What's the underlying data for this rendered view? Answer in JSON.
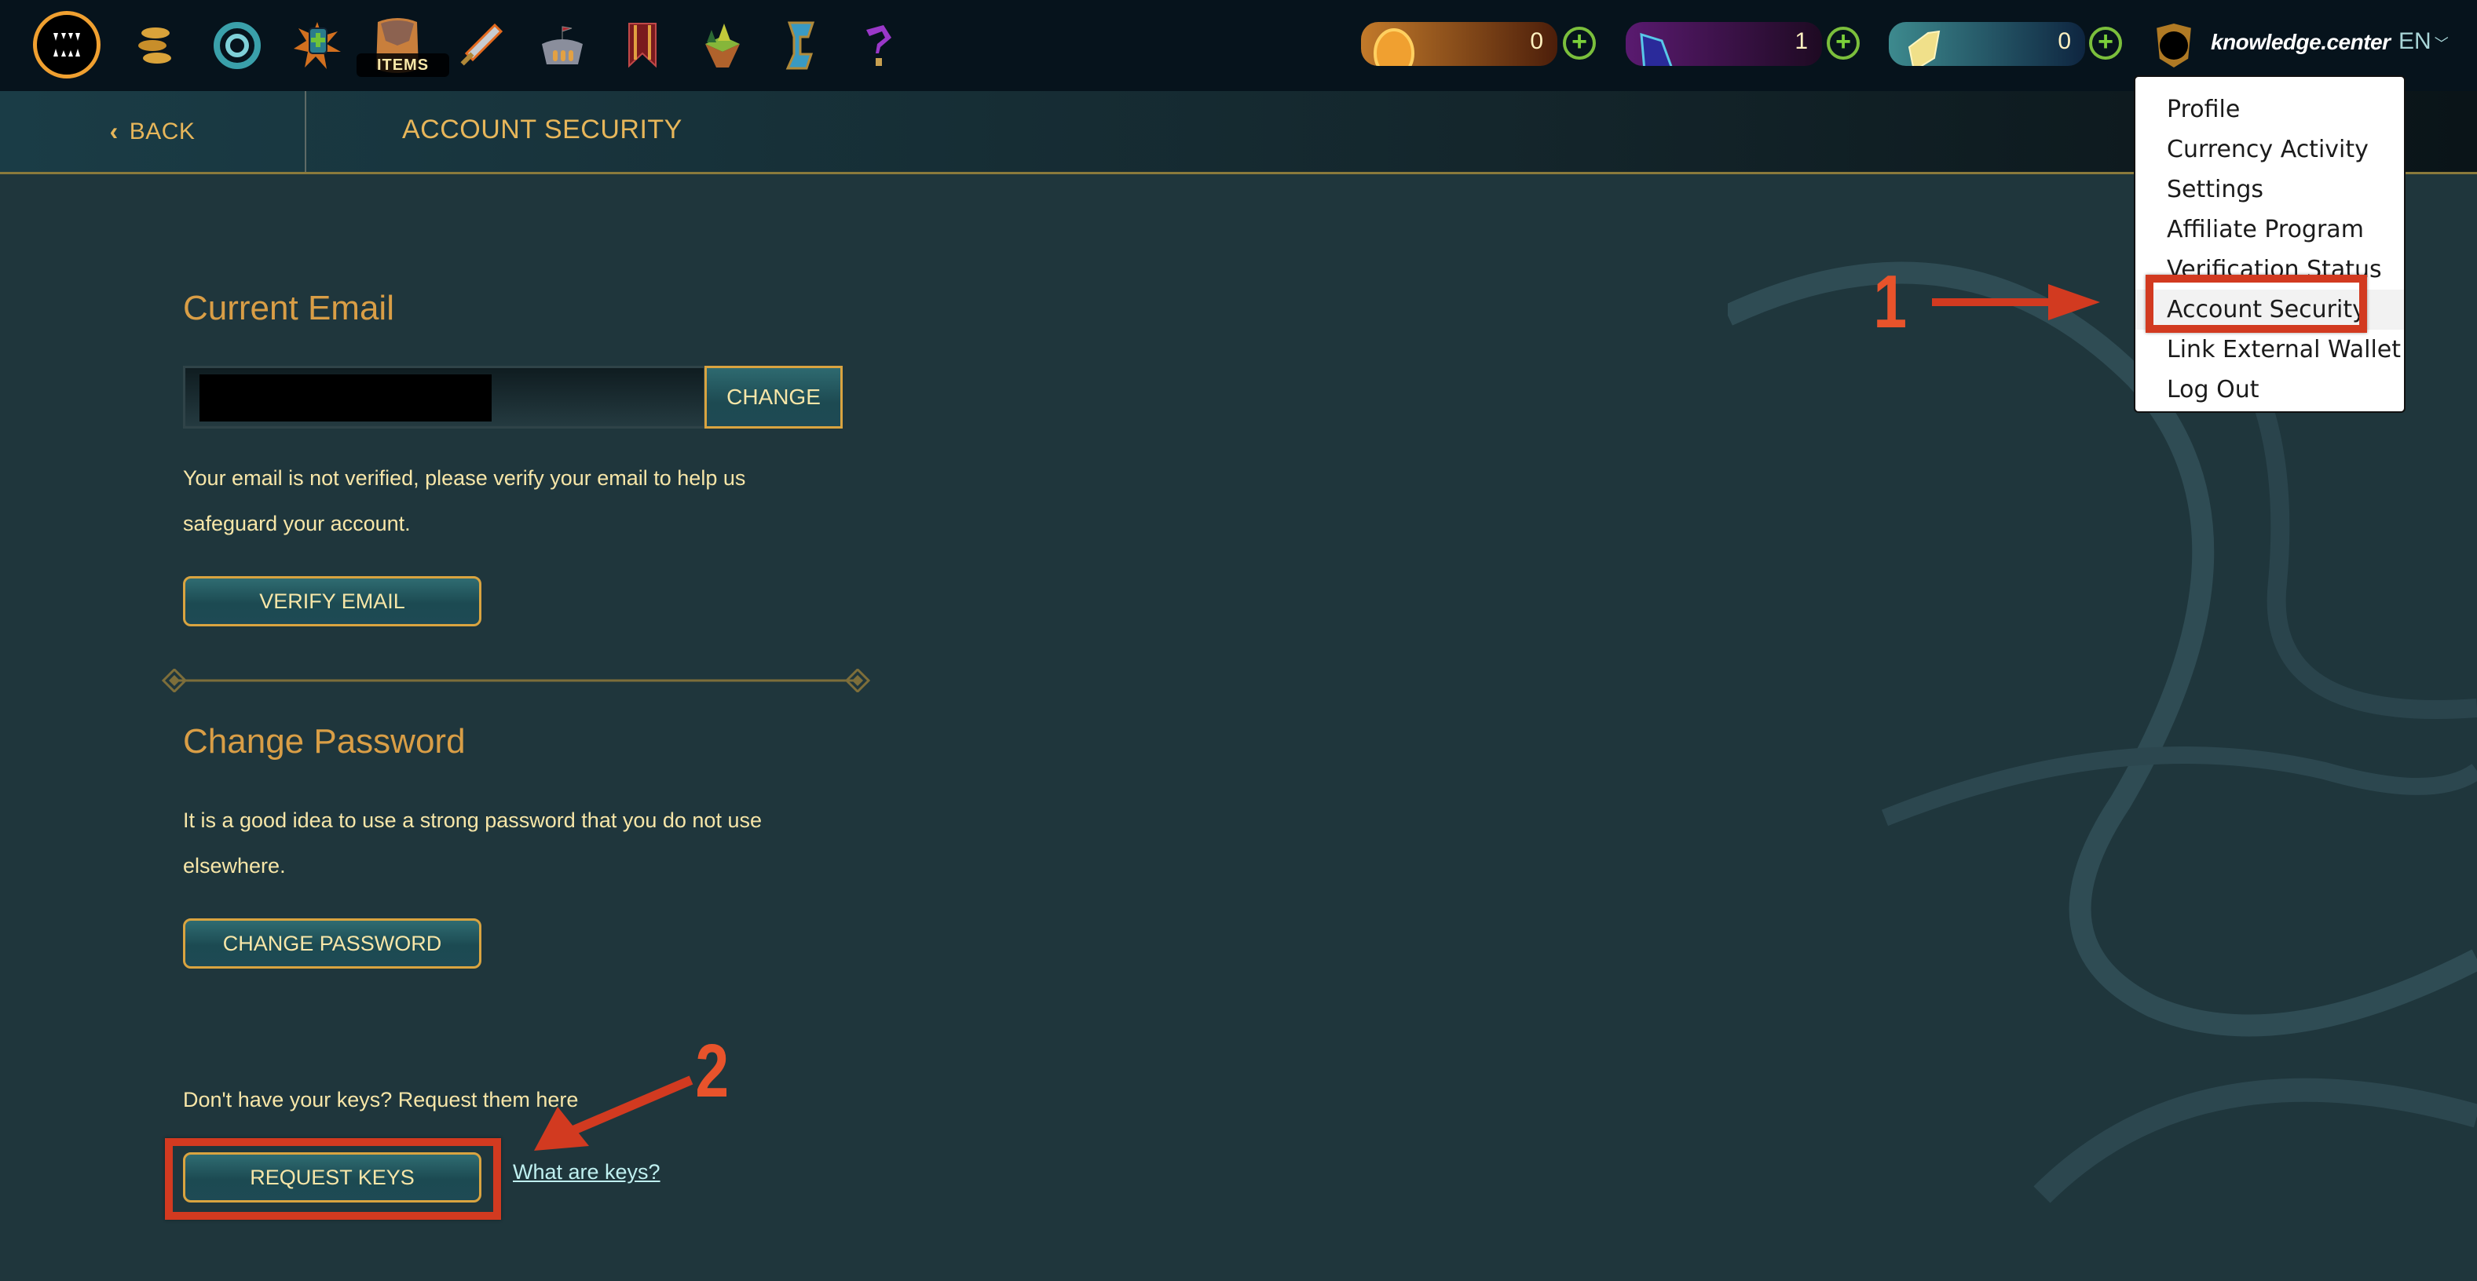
{
  "topbar": {
    "nav_icons": [
      {
        "name": "logo-fangs-icon"
      },
      {
        "name": "coins-icon"
      },
      {
        "name": "portal-swirl-icon"
      },
      {
        "name": "shield-burst-icon"
      },
      {
        "name": "items-bag-icon",
        "label": "ITEMS"
      },
      {
        "name": "flaming-sword-icon"
      },
      {
        "name": "arena-icon"
      },
      {
        "name": "banner-icon"
      },
      {
        "name": "floating-island-icon"
      },
      {
        "name": "rune-s-icon"
      },
      {
        "name": "question-icon"
      }
    ],
    "items_label": "ITEMS",
    "currencies": [
      {
        "name": "gold-coin",
        "value": "0",
        "color": "#c27a2a"
      },
      {
        "name": "purple-crystal",
        "value": "1",
        "color": "#5a1a70"
      },
      {
        "name": "teal-shard",
        "value": "0",
        "color": "#3d8a8e"
      }
    ],
    "username": "knowledge.center",
    "language": "EN"
  },
  "subheader": {
    "back_label": "BACK",
    "page_title": "ACCOUNT SECURITY"
  },
  "email_section": {
    "title": "Current Email",
    "email_value": "[redacted]",
    "change_label": "CHANGE",
    "notice_line1": "Your email is not verified, please verify your email to help us",
    "notice_line2": "safeguard your account.",
    "verify_label": "VERIFY EMAIL"
  },
  "password_section": {
    "title": "Change Password",
    "notice_line1": "It is a good idea to use a strong password that you do not use",
    "notice_line2": "elsewhere.",
    "change_password_label": "CHANGE PASSWORD"
  },
  "keys_section": {
    "prompt": "Don't have your keys? Request them here",
    "request_label": "REQUEST KEYS",
    "help_link": "What are keys?"
  },
  "dropdown": {
    "items": [
      {
        "label": "Profile"
      },
      {
        "label": "Currency Activity"
      },
      {
        "label": "Settings"
      },
      {
        "label": "Affiliate Program"
      },
      {
        "label": "Verification Status"
      },
      {
        "label": "Account Security",
        "active": true
      },
      {
        "label": "Link External Wallet"
      },
      {
        "label": "Log Out"
      }
    ]
  },
  "annotations": {
    "step1": "1",
    "step2": "2",
    "color": "#d23a20"
  },
  "colors": {
    "gold_text": "#d99e46",
    "cream_text": "#f7e6a8",
    "background": "#1f363c",
    "topbar": "#06131c",
    "plus_green": "#7bbf3c"
  }
}
